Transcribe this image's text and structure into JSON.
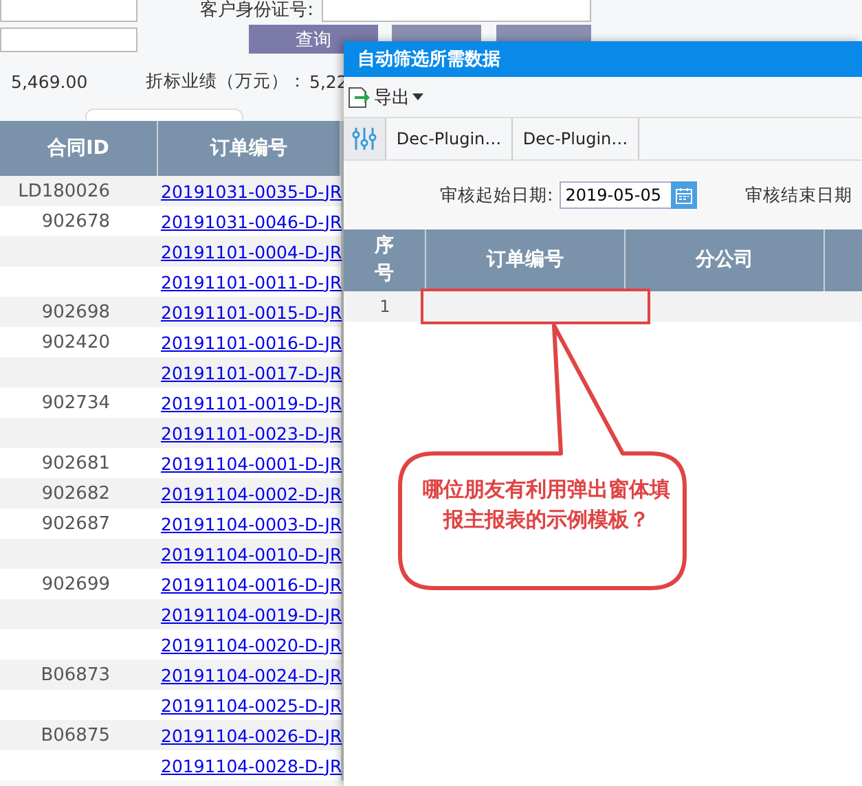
{
  "search_form": {
    "id_label": "客户身份证号:",
    "query_button": "查询"
  },
  "summary": {
    "amount": "5,469.00",
    "converted_label": "折标业绩（万元）：",
    "converted_value": "5,22"
  },
  "table": {
    "columns": [
      "合同ID",
      "订单编号"
    ],
    "rows": [
      {
        "contract_id": "LD180026",
        "order_no": "20191031-0035-D-JR"
      },
      {
        "contract_id": "902678",
        "order_no": "20191031-0046-D-JR"
      },
      {
        "order_no": "20191101-0004-D-JR"
      },
      {
        "order_no": "20191101-0011-D-JR"
      },
      {
        "contract_id": "902698",
        "order_no": "20191101-0015-D-JR"
      },
      {
        "contract_id": "902420",
        "order_no": "20191101-0016-D-JR"
      },
      {
        "order_no": "20191101-0017-D-JR"
      },
      {
        "contract_id": "902734",
        "order_no": "20191101-0019-D-JR"
      },
      {
        "order_no": "20191101-0023-D-JR"
      },
      {
        "contract_id": "902681",
        "order_no": "20191104-0001-D-JR"
      },
      {
        "contract_id": "902682",
        "order_no": "20191104-0002-D-JR"
      },
      {
        "contract_id": "902687",
        "order_no": "20191104-0003-D-JR"
      },
      {
        "order_no": "20191104-0010-D-JR"
      },
      {
        "contract_id": "902699",
        "order_no": "20191104-0016-D-JR"
      },
      {
        "order_no": "20191104-0019-D-JR"
      },
      {
        "order_no": "20191104-0020-D-JR"
      },
      {
        "contract_id": "B06873",
        "order_no": "20191104-0024-D-JR"
      },
      {
        "order_no": "20191104-0025-D-JR"
      },
      {
        "contract_id": "B06875",
        "order_no": "20191104-0026-D-JR"
      },
      {
        "order_no": "20191104-0028-D-JR"
      }
    ]
  },
  "dialog": {
    "title": "自动筛选所需数据",
    "export_label": "导出",
    "tabs": [
      "Dec-Plugin…",
      "Dec-Plugin…"
    ],
    "filters": {
      "start_label": "审核起始日期:",
      "start_value": "2019-05-05",
      "end_label": "审核结束日期"
    },
    "grid": {
      "columns": [
        "序号",
        "订单编号",
        "分公司"
      ],
      "rows": [
        {
          "index": "1"
        }
      ]
    }
  },
  "callout": {
    "text": "哪位朋友有利用弹出窗体填报主报表的示例模板？"
  }
}
